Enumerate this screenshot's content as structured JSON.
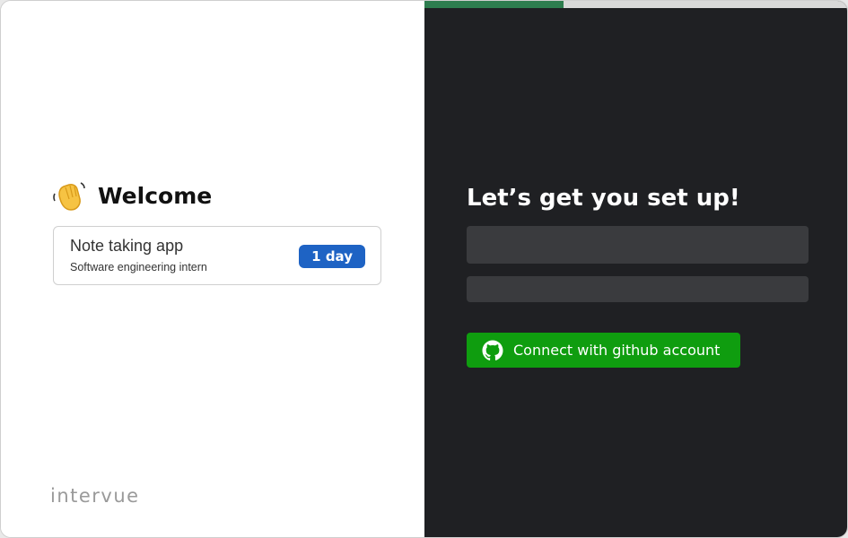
{
  "welcome": {
    "icon": "waving-hand-icon",
    "title": "Welcome"
  },
  "job_card": {
    "title": "Note taking app",
    "subtitle": "Software engineering intern",
    "badge": "1 day"
  },
  "brand": {
    "logo_text": "intervue"
  },
  "setup": {
    "title": "Let’s get you set up!",
    "field_1_value": "",
    "field_2_value": "",
    "github_button_label": "Connect with github account",
    "github_icon": "github-icon"
  },
  "progress": {
    "fraction": 0.33
  },
  "colors": {
    "right_panel_bg": "#1f2023",
    "accent_green": "#0f9d0f",
    "progress_green": "#2e7d4f",
    "badge_blue": "#1e63c4"
  }
}
